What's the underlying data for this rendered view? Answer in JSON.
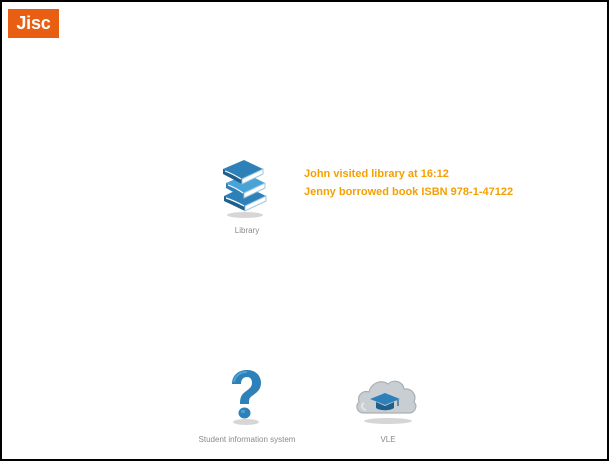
{
  "brand": {
    "logo_text": "Jisc",
    "logo_color": "#e85e13"
  },
  "systems": {
    "library": {
      "icon": "books-icon",
      "label": "Library"
    },
    "student_information_system": {
      "icon": "question-mark-icon",
      "label": "Student information system"
    },
    "vle": {
      "icon": "cloud-graduation-cap-icon",
      "label": "VLE"
    }
  },
  "events": {
    "color": "#f5a000",
    "items": [
      "John visited library at 16:12",
      "Jenny borrowed book ISBN 978-1-47122"
    ]
  },
  "colors": {
    "icon_blue": "#2e80b8",
    "icon_light_blue": "#4aa3d6",
    "caption_gray": "#8a8a8a"
  }
}
